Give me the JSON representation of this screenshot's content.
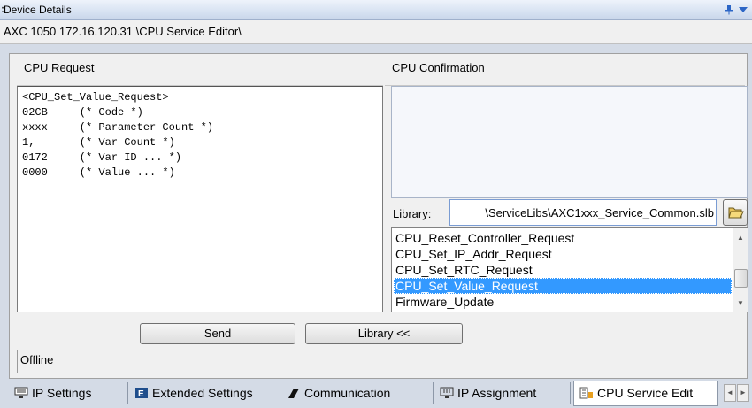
{
  "window": {
    "title": "Device Details"
  },
  "path": "AXC 1050 172.16.120.31 \\CPU Service Editor\\",
  "request": {
    "header": "CPU Request",
    "lines": [
      "<CPU_Set_Value_Request>",
      "02CB     (* Code *)",
      "xxxx     (* Parameter Count *)",
      "1,       (* Var Count *)",
      "0172     (* Var ID ... *)",
      "0000     (* Value ... *)"
    ]
  },
  "confirmation": {
    "header": "CPU Confirmation"
  },
  "library": {
    "label": "Library:",
    "value": "\\ServiceLibs\\AXC1xxx_Service_Common.slb",
    "items": [
      "CPU_Reset_Controller_Request",
      "CPU_Set_IP_Addr_Request",
      "CPU_Set_RTC_Request",
      "CPU_Set_Value_Request",
      "Firmware_Update"
    ],
    "selected_index": 3
  },
  "buttons": {
    "send": "Send",
    "library": "Library <<"
  },
  "status": "Offline",
  "tabs": [
    {
      "label": "IP Settings",
      "icon": "network-icon"
    },
    {
      "label": "Extended Settings",
      "icon": "extended-icon"
    },
    {
      "label": "Communication",
      "icon": "plug-icon"
    },
    {
      "label": "IP Assignment",
      "icon": "monitor-icon"
    },
    {
      "label": "CPU Service Edit",
      "icon": "service-icon"
    }
  ],
  "colors": {
    "selection": "#3399ff",
    "titlebar": "#d7e2f2"
  }
}
